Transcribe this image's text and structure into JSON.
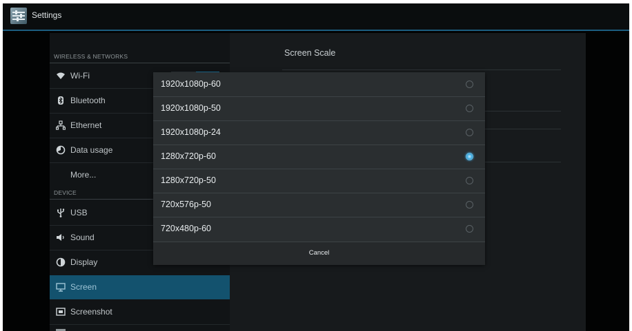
{
  "app": {
    "title": "Settings",
    "icon": "settings-icon"
  },
  "sidebar": {
    "sections": [
      {
        "header": "WIRELESS & NETWORKS"
      },
      {
        "header": "DEVICE"
      }
    ],
    "items": [
      {
        "label": "Wi-Fi",
        "icon": "wifi-icon"
      },
      {
        "label": "Bluetooth",
        "icon": "bluetooth-icon"
      },
      {
        "label": "Ethernet",
        "icon": "ethernet-icon"
      },
      {
        "label": "Data usage",
        "icon": "data-usage-icon"
      },
      {
        "label": "More...",
        "icon": ""
      },
      {
        "label": "USB",
        "icon": "usb-icon"
      },
      {
        "label": "Sound",
        "icon": "sound-icon"
      },
      {
        "label": "Display",
        "icon": "display-icon"
      },
      {
        "label": "Screen",
        "icon": "screen-icon",
        "selected": true
      },
      {
        "label": "Screenshot",
        "icon": "screenshot-icon"
      }
    ]
  },
  "detail": {
    "title": "Screen Scale"
  },
  "dialog": {
    "options": [
      {
        "label": "1920x1080p-60",
        "checked": false
      },
      {
        "label": "1920x1080p-50",
        "checked": false
      },
      {
        "label": "1920x1080p-24",
        "checked": false
      },
      {
        "label": "1280x720p-60",
        "checked": true
      },
      {
        "label": "1280x720p-50",
        "checked": false
      },
      {
        "label": "720x576p-50",
        "checked": false
      },
      {
        "label": "720x480p-60",
        "checked": false
      }
    ],
    "cancel_label": "Cancel"
  },
  "colors": {
    "accent": "#33b5e5",
    "selected_row": "#13526e",
    "background": "#020303"
  }
}
